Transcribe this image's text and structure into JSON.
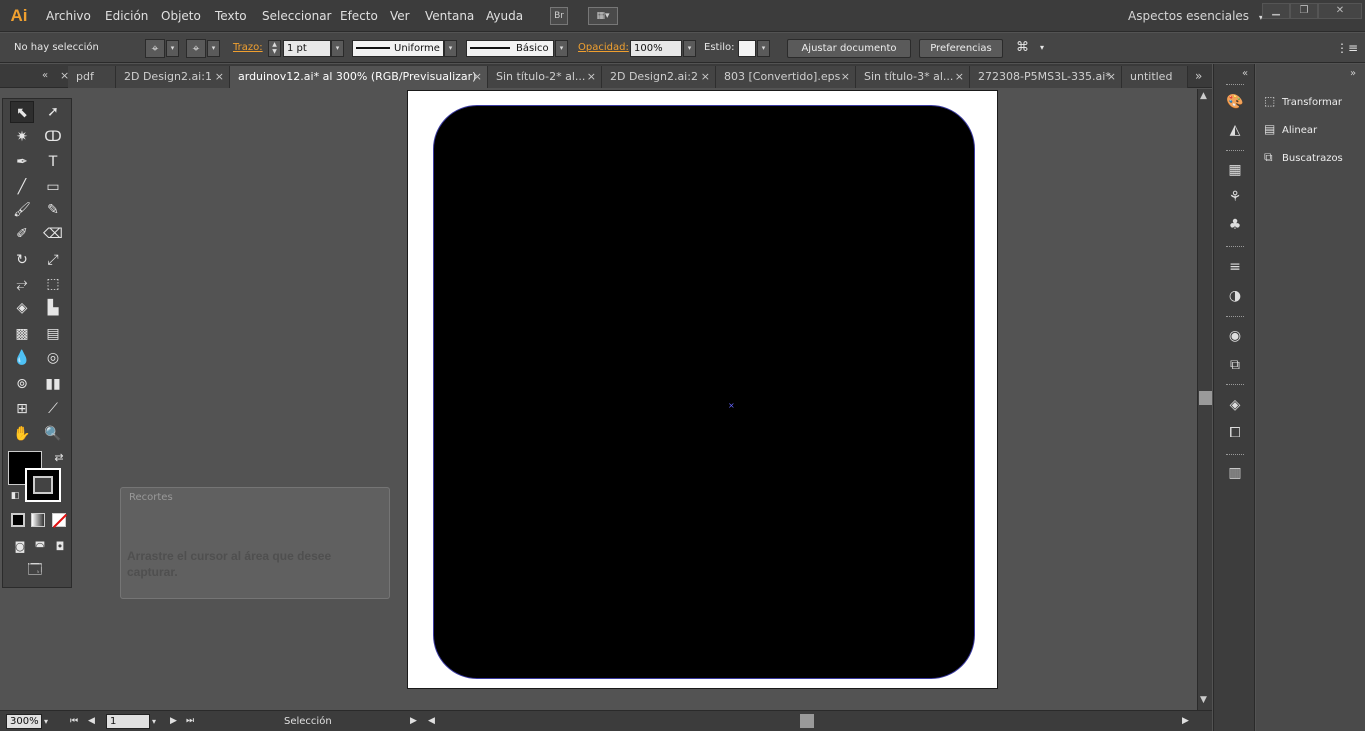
{
  "app": {
    "logo": "Ai"
  },
  "menu": [
    "Archivo",
    "Edición",
    "Objeto",
    "Texto",
    "Seleccionar",
    "Efecto",
    "Ver",
    "Ventana",
    "Ayuda"
  ],
  "bridge_btn": "Br",
  "workspace": "Aspectos esenciales",
  "control": {
    "selection": "No hay selección",
    "stroke_label": "Trazo:",
    "stroke_value": "1 pt",
    "profile": "Uniforme",
    "brush": "Básico",
    "opacity_label": "Opacidad:",
    "opacity_value": "100%",
    "style_label": "Estilo:",
    "adjust_doc": "Ajustar documento",
    "preferences": "Preferencias"
  },
  "tabs": [
    {
      "label": "pdf"
    },
    {
      "label": "2D Design2.ai:1"
    },
    {
      "label": "arduinov12.ai* al 300% (RGB/Previsualizar)",
      "active": true
    },
    {
      "label": "Sin título-2* al..."
    },
    {
      "label": "2D Design2.ai:2"
    },
    {
      "label": "803 [Convertido].eps"
    },
    {
      "label": "Sin título-3* al..."
    },
    {
      "label": "272308-P5MS3L-335.ai*"
    },
    {
      "label": "untitled"
    }
  ],
  "dialog": {
    "title": "Recortes",
    "text": "Arrastre el cursor al área que desee capturar."
  },
  "status": {
    "zoom": "300%",
    "page": "1",
    "tool": "Selección"
  },
  "panels": [
    {
      "label": "Transformar",
      "icon": "transform-icon"
    },
    {
      "label": "Alinear",
      "icon": "align-icon"
    },
    {
      "label": "Buscatrazos",
      "icon": "pathfinder-icon"
    }
  ],
  "colors": {
    "accent": "#f0a030",
    "fill": "#000000",
    "stroke_outline": "#3a3aa0"
  }
}
